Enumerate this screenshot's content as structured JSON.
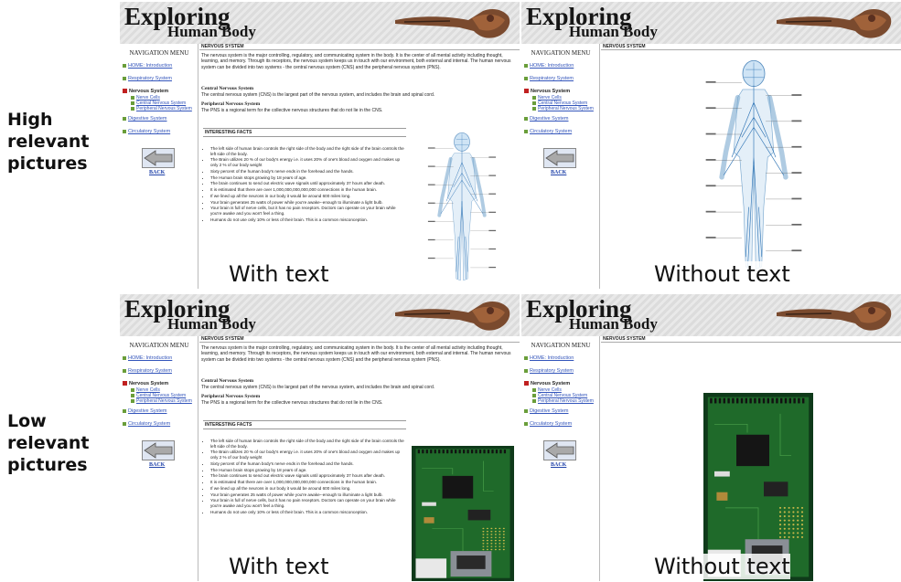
{
  "row_labels": {
    "high": "High relevant pictures",
    "low": "Low relevant pictures"
  },
  "site": {
    "title_top": "Exploring",
    "title_bottom": "Human Body",
    "nav_heading": "NAVIGATION MENU",
    "nav": [
      "HOME: Introduction",
      "Respiratory System",
      "Nervous System",
      "Digestive System",
      "Circulatory System"
    ],
    "nav_sub": [
      "Nerve Cells",
      "Central Nervous System",
      "Peripheral Nervous System"
    ],
    "back": "BACK",
    "section": "NERVOUS SYSTEM",
    "intro": "The nervous system is the major controlling, regulatory, and communicating system in the body. It is the center of all mental activity including thought, learning, and memory. Through its receptors, the nervous system keeps us in touch with our environment, both external and internal. The human nervous system can be divided into two systems - the central nervous system (CNS) and the peripheral nervous system (PNS).",
    "cns_h": "Central Nervous System",
    "cns": "The central nervous system (CNS) is the largest part of the nervous system, and includes the brain and spinal cord.",
    "pns_h": "Peripheral Nervous System",
    "pns": "The PNS is a regional term for the collective nervous structures that do not lie in the CNS.",
    "facts_h": "INTERESTING FACTS",
    "facts": [
      "The left side of human brain controls the right side of the body and the right side of the brain controls the left side of the body.",
      "The Brain utilizes 20 % of our body's energy i.e. it uses 20% of one's blood and oxygen and makes up only 2 % of our body weight",
      "Sixty percent of the human body's nerve ends in the forehead and the hands.",
      "The Human brain stops growing by 18 years of age.",
      "The brain continues to send out electric wave signals until approximately 37 hours after death.",
      "It is estimated that there are over 1,000,000,000,000,000 connections in the human brain.",
      "If we lined up all the neurons in our body it would be around 600 miles long.",
      "Your brain generates 25 watts of power while you're awake--enough to illuminate a light bulb.",
      "Your brain is full of nerve cells, but it has no pain receptors. Doctors can operate on your brain while you're awake and you won't feel a thing.",
      "Humans do not use only 10% or less of their brain. This is a common misconception."
    ]
  },
  "captions": {
    "with": "With text",
    "without": "Without text"
  }
}
